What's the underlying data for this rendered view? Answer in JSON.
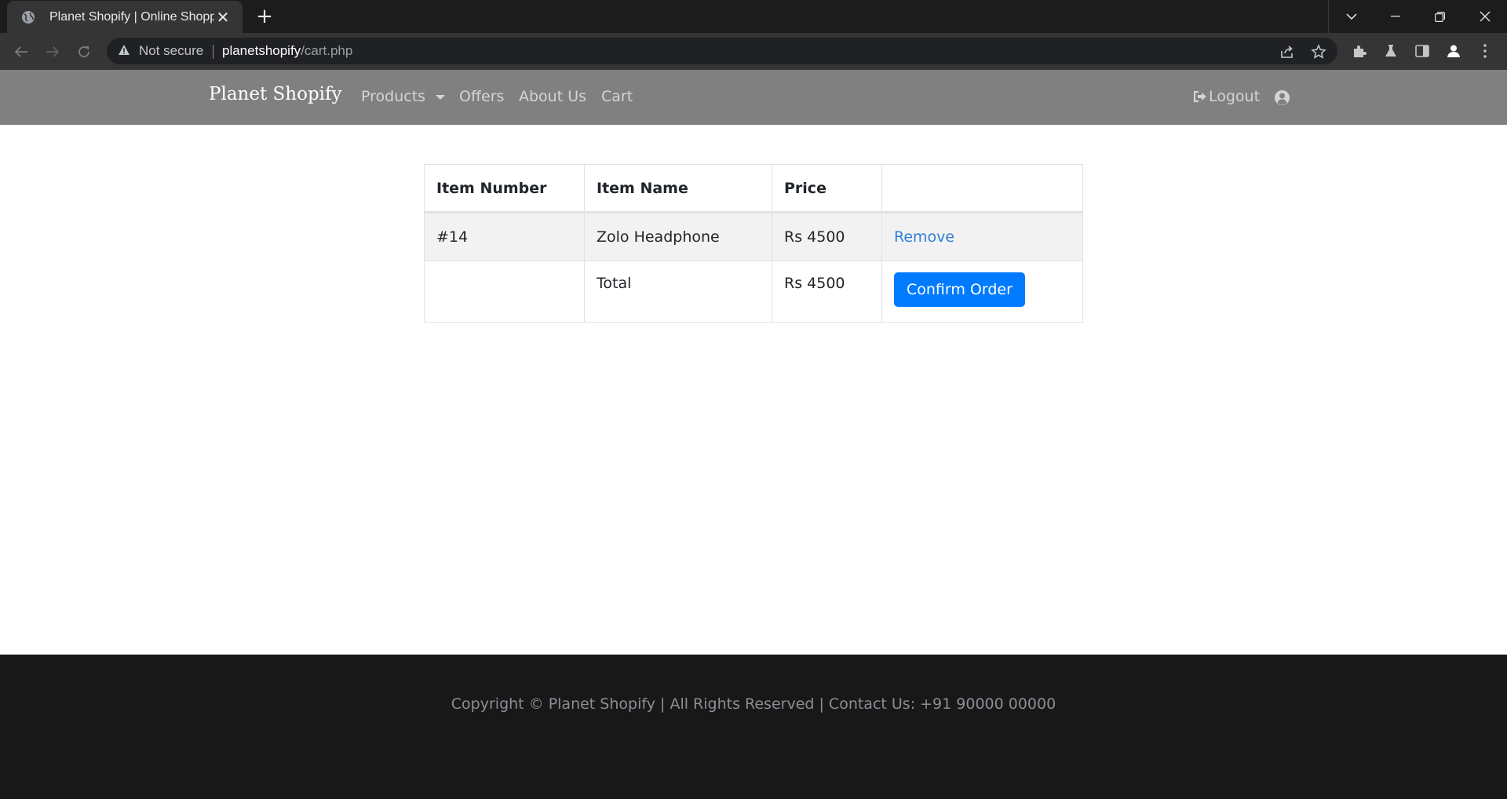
{
  "browser": {
    "tab_title": "Planet Shopify | Online Shopping",
    "tab_close": "✕",
    "new_tab": "+",
    "security_label": "Not secure",
    "url_host": "planetshopify",
    "url_path": "/cart.php",
    "icons": [
      "back-icon",
      "forward-icon",
      "reload-icon",
      "warning-icon",
      "share-icon",
      "star-icon",
      "extensions-icon",
      "labs-icon",
      "side-panel-icon",
      "profile-icon",
      "menu-icon"
    ]
  },
  "navbar": {
    "brand": "Planet Shopify",
    "links": [
      "Products",
      "Offers",
      "About Us",
      "Cart"
    ],
    "logout": "Logout"
  },
  "cart": {
    "headers": [
      "Item Number",
      "Item Name",
      "Price",
      ""
    ],
    "items": [
      {
        "number": "#14",
        "name": "Zolo Headphone",
        "price": "Rs 4500",
        "action": "Remove"
      }
    ],
    "total_label": "Total",
    "total_value": "Rs 4500",
    "confirm_label": "Confirm Order"
  },
  "footer": {
    "text": "Copyright © Planet Shopify | All Rights Reserved | Contact Us: +91 90000 00000"
  },
  "colors": {
    "navbar_bg": "#808080",
    "primary_button": "#007bff",
    "link": "#2f7fd4",
    "footer_bg": "#181818"
  }
}
